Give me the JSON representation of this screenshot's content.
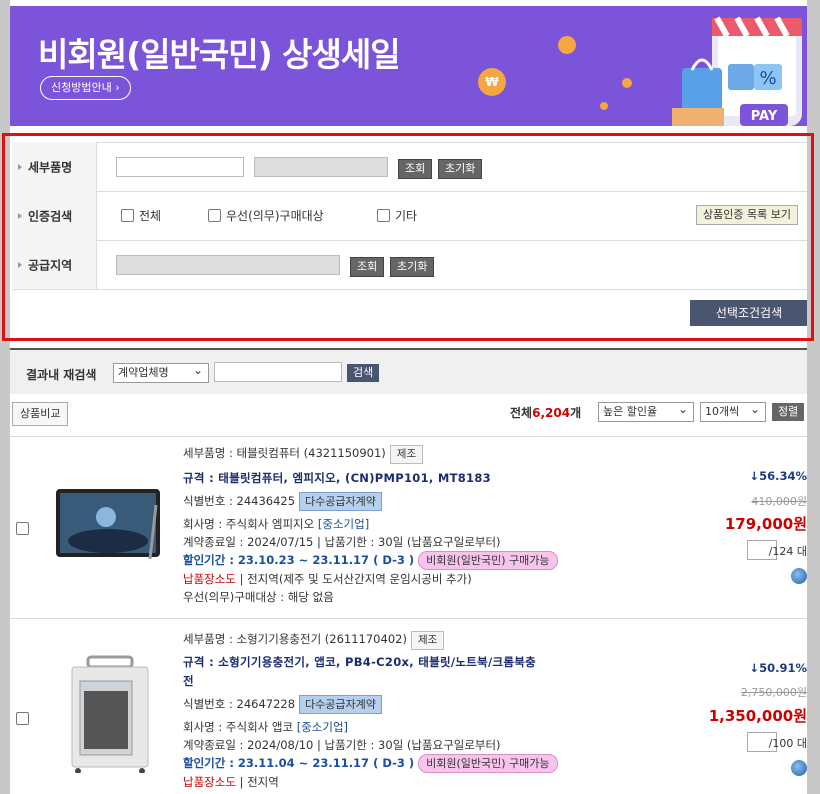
{
  "banner": {
    "title": "비회원(일반국민) 상생세일",
    "guide_button": "신청방법안내 ›",
    "pay_label": "PAY",
    "percent_label": "%",
    "won_symbol": "₩"
  },
  "search": {
    "rows": [
      {
        "label": "세부품명"
      },
      {
        "label": "인증검색"
      },
      {
        "label": "공급지역"
      }
    ],
    "query_button": "조회",
    "reset_button": "초기화",
    "cert_options": [
      "전체",
      "우선(의무)구매대상",
      "기타"
    ],
    "cert_list_button": "상품인증 목록 보기",
    "search_selected_button": "선택조건검색"
  },
  "research": {
    "label": "결과내 재검색",
    "field_select": "계약업체명",
    "search_button": "검색"
  },
  "toolbar": {
    "compare_button": "상품비교",
    "total_label": "전체",
    "total_count": "6,204",
    "total_unit": "개",
    "sort_select": "높은 할인율",
    "page_size_select": "10개씩",
    "sort_button": "정렬"
  },
  "products": [
    {
      "detail_name": "세부품명 : 태블릿컴퓨터 (4321150901)",
      "type_tag": "제조",
      "spec": "규격 : 태블릿컴퓨터, 엠피지오, (CN)PMP101, MT8183",
      "spec_line2": "",
      "id_label": "식별번호 : 24436425",
      "contract_tag": "다수공급자계약",
      "company_label": "회사명 : 주식회사 엠피지오",
      "company_type": "[중소기업]",
      "contract_info": "계약종료일 : 2024/07/15 | 납품기한 : 30일 (납품요구일로부터)",
      "sale_period": "할인기간 : 23.10.23 ~ 23.11.17 ( D-3 )",
      "nonmember_tag": "비회원(일반국민) 구매가능",
      "delivery_label": "납품장소도",
      "delivery_value": "| 전지역(제주 및 도서산간지역 운임시공비 추가)",
      "priority_label": "우선(의무)구매대상 : 해당 없음",
      "discount": "56.34%",
      "original_price": "410,000원",
      "price": "179,000원",
      "unit": "/124 대"
    },
    {
      "detail_name": "세부품명 : 소형기기용충전기 (2611170402)",
      "type_tag": "제조",
      "spec": "규격 : 소형기기용충전기, 앱코, PB4-C20x, 태블릿/노트북/크롬북충",
      "spec_line2": "전",
      "id_label": "식별번호 : 24647228",
      "contract_tag": "다수공급자계약",
      "company_label": "회사명 : 주식회사 앱코",
      "company_type": "[중소기업]",
      "contract_info": "계약종료일 : 2024/08/10 | 납품기한 : 30일 (납품요구일로부터)",
      "sale_period": "할인기간 : 23.11.04 ~ 23.11.17 ( D-3 )",
      "nonmember_tag": "비회원(일반국민) 구매가능",
      "delivery_label": "납품장소도",
      "delivery_value": "| 전지역",
      "priority_label": "",
      "discount": "50.91%",
      "original_price": "2,750,000원",
      "price": "1,350,000원",
      "unit": "/100 대"
    }
  ],
  "colors": {
    "banner": "#7b54d9",
    "highlight_box": "#e01010",
    "price": "#cc0000",
    "spec": "#1c2c70"
  }
}
